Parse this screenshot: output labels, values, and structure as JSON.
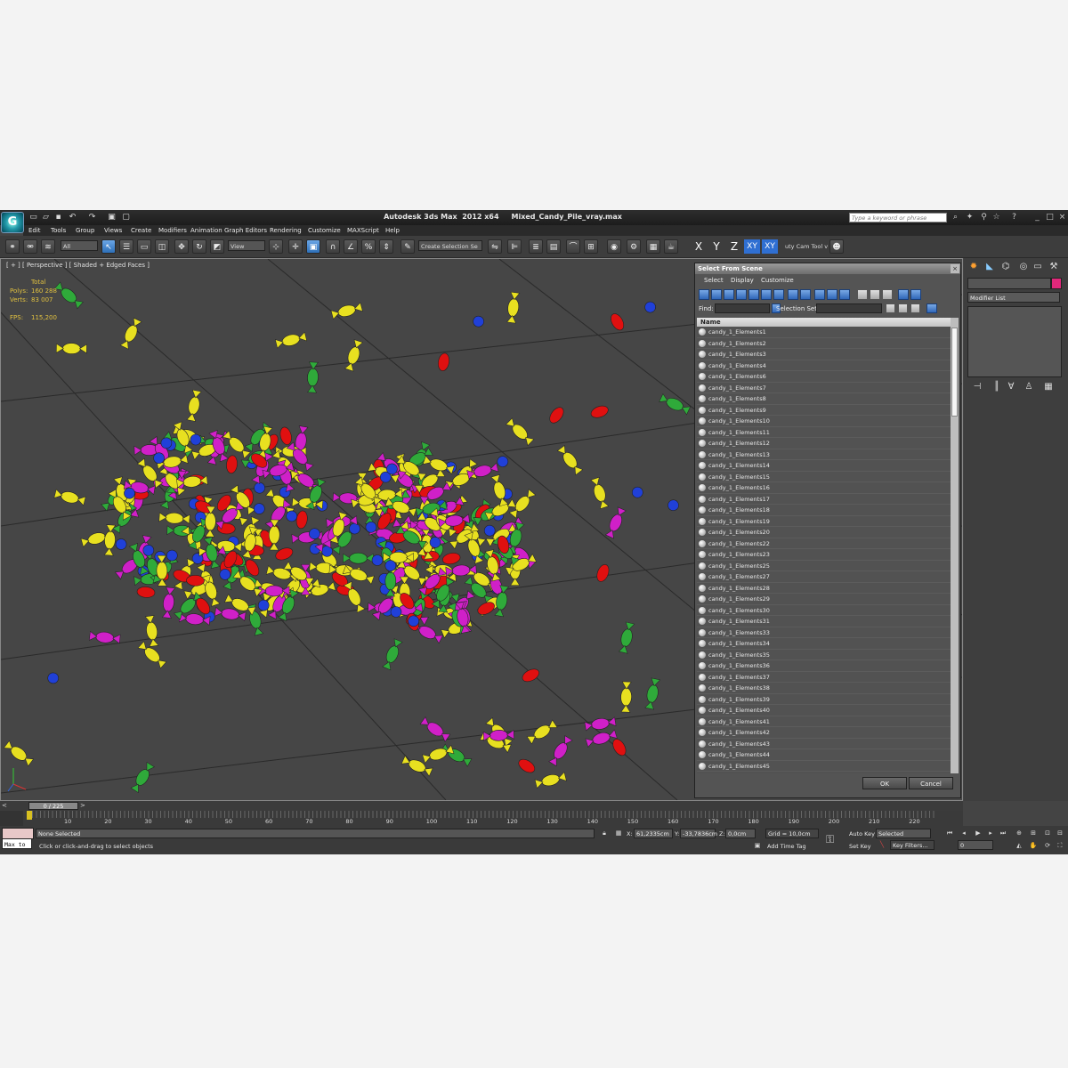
{
  "window": {
    "title": "Autodesk 3ds Max  2012 x64     Mixed_Candy_Pile_vray.max",
    "logo_letter": "G",
    "keyword_placeholder": "Type a keyword or phrase"
  },
  "menu": [
    "Edit",
    "Tools",
    "Group",
    "Views",
    "Create",
    "Modifiers",
    "Animation",
    "Graph Editors",
    "Rendering",
    "Customize",
    "MAXScript",
    "Help"
  ],
  "toolbar": {
    "filter_value": "All",
    "coord_value": "View",
    "selection_set_placeholder": "Create Selection Se",
    "axes": [
      "X",
      "Y",
      "Z",
      "XY",
      "XY"
    ],
    "util_label": "uty Cam Tool v"
  },
  "viewport": {
    "label": "[ + ] [ Perspective ] [ Shaded + Edged Faces ]",
    "stats": {
      "header": "Total",
      "polys_label": "Polys:",
      "polys": "160 288",
      "verts_label": "Verts:",
      "verts": "83 007",
      "fps_label": "FPS:",
      "fps": "115,200"
    }
  },
  "dialog": {
    "title": "Select From Scene",
    "menus": [
      "Select",
      "Display",
      "Customize"
    ],
    "find_label": "Find:",
    "selset_label": "Selection Set:",
    "column": "Name",
    "items": [
      "candy_1_Elements1",
      "candy_1_Elements2",
      "candy_1_Elements3",
      "candy_1_Elements4",
      "candy_1_Elements6",
      "candy_1_Elements7",
      "candy_1_Elements8",
      "candy_1_Elements9",
      "candy_1_Elements10",
      "candy_1_Elements11",
      "candy_1_Elements12",
      "candy_1_Elements13",
      "candy_1_Elements14",
      "candy_1_Elements15",
      "candy_1_Elements16",
      "candy_1_Elements17",
      "candy_1_Elements18",
      "candy_1_Elements19",
      "candy_1_Elements20",
      "candy_1_Elements22",
      "candy_1_Elements23",
      "candy_1_Elements25",
      "candy_1_Elements27",
      "candy_1_Elements28",
      "candy_1_Elements29",
      "candy_1_Elements30",
      "candy_1_Elements31",
      "candy_1_Elements33",
      "candy_1_Elements34",
      "candy_1_Elements35",
      "candy_1_Elements36",
      "candy_1_Elements37",
      "candy_1_Elements38",
      "candy_1_Elements39",
      "candy_1_Elements40",
      "candy_1_Elements41",
      "candy_1_Elements42",
      "candy_1_Elements43",
      "candy_1_Elements44",
      "candy_1_Elements45"
    ],
    "ok": "OK",
    "cancel": "Cancel"
  },
  "command_panel": {
    "modifier_list": "Modifier List"
  },
  "timeline": {
    "frame": "0 / 225",
    "ticks": [
      "10",
      "20",
      "30",
      "40",
      "50",
      "60",
      "70",
      "80",
      "90",
      "100",
      "110",
      "120",
      "130",
      "140",
      "150",
      "160",
      "170",
      "180",
      "190",
      "200",
      "210",
      "220"
    ]
  },
  "status": {
    "maxscript": "Max to",
    "selection": "None Selected",
    "prompt": "Click or click-and-drag to select objects",
    "x_label": "X:",
    "x": "61,2335cm",
    "y_label": "Y:",
    "y": "-33,7836cm",
    "z_label": "Z:",
    "z": "0,0cm",
    "grid": "Grid = 10,0cm",
    "add_time_tag": "Add Time Tag",
    "auto_key": "Auto Key",
    "set_key": "Set Key",
    "key_mode": "Selected",
    "key_filters": "Key Filters...",
    "frame_field": "0"
  },
  "colors": {
    "yellow": "#e8e020",
    "red": "#e01010",
    "green": "#2faa3a",
    "blue": "#2040d8",
    "magenta": "#d020c8"
  }
}
